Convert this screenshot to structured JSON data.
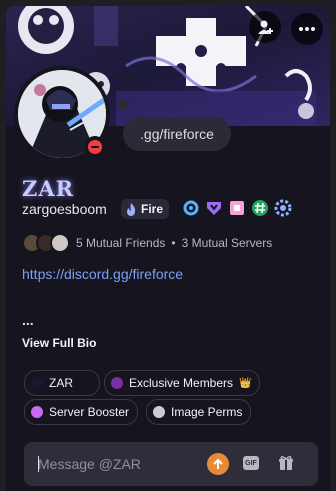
{
  "profile": {
    "display_name": "ZAR",
    "username": "zargoesboom",
    "status": "dnd",
    "custom_status": ".gg/fireforce",
    "guild_tag": {
      "icon": "fire-icon",
      "label": "Fire"
    },
    "badges": [
      "nitro-ring-badge",
      "hypesquad-balance-badge",
      "pink-square-badge",
      "hashtag-badge",
      "gear-badge"
    ],
    "mutual_friends": "5 Mutual Friends",
    "mutual_separator": "•",
    "mutual_servers": "3 Mutual Servers",
    "bio_link": "https://discord.gg/fireforce",
    "bio_more": "...",
    "view_full_bio": "View Full Bio"
  },
  "roles": [
    {
      "label": "ZAR",
      "color": "#1a1830"
    },
    {
      "label": "Exclusive Members",
      "color": "#7b2ea0",
      "suffix": "👑"
    },
    {
      "label": "Server Booster",
      "color": "#c86af2"
    },
    {
      "label": "Image Perms",
      "color": "#c9cbd1"
    }
  ],
  "message": {
    "placeholder": "Message @ZAR",
    "gif_label": "GIF"
  },
  "colors": {
    "accent": "#c9cbfb",
    "link": "#7e9ff2",
    "dnd": "#f23f43",
    "boost": "#e78b3a"
  }
}
